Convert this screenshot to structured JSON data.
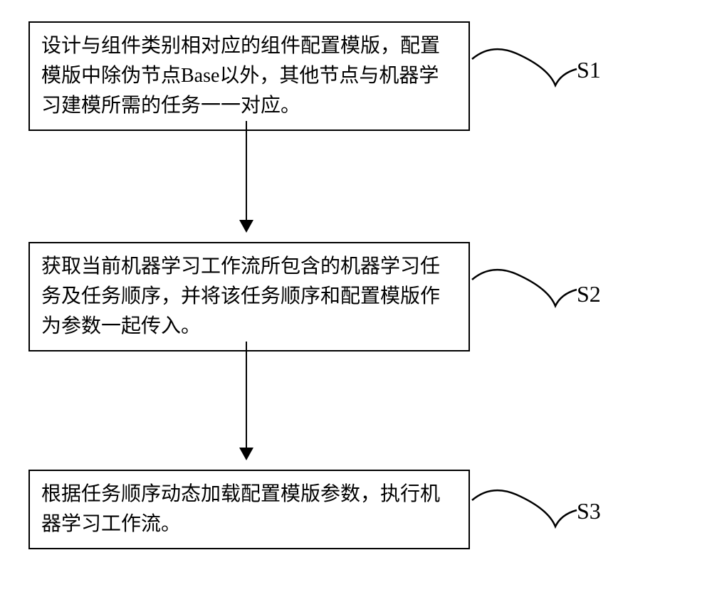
{
  "flowchart": {
    "steps": [
      {
        "text": "设计与组件类别相对应的组件配置模版，配置模版中除伪节点Base以外，其他节点与机器学习建模所需的任务一一对应。",
        "label": "S1"
      },
      {
        "text": "获取当前机器学习工作流所包含的机器学习任务及任务顺序，并将该任务顺序和配置模版作为参数一起传入。",
        "label": "S2"
      },
      {
        "text": "根据任务顺序动态加载配置模版参数，执行机器学习工作流。",
        "label": "S3"
      }
    ]
  }
}
